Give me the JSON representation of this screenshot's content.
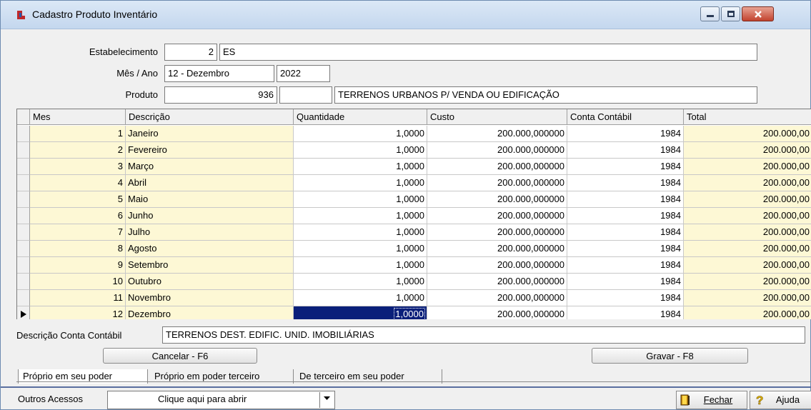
{
  "window": {
    "title": "Cadastro Produto  Inventário"
  },
  "form": {
    "estabelecimento_label": "Estabelecimento",
    "estabelecimento_code": "2",
    "estabelecimento_name": "ES",
    "mes_ano_label": "Mês / Ano",
    "mes_value": "12 - Dezembro",
    "ano_value": "2022",
    "produto_label": "Produto",
    "produto_code": "936",
    "produto_extra": "",
    "produto_desc": "TERRENOS URBANOS P/ VENDA OU EDIFICAÇÃO"
  },
  "grid": {
    "columns": [
      "Mes",
      "Descrição",
      "Quantidade",
      "Custo",
      "Conta Contábil",
      "Total"
    ],
    "rows": [
      {
        "mes": "1",
        "descricao": "Janeiro",
        "quantidade": "1,0000",
        "custo": "200.000,000000",
        "conta": "1984",
        "total": "200.000,00"
      },
      {
        "mes": "2",
        "descricao": "Fevereiro",
        "quantidade": "1,0000",
        "custo": "200.000,000000",
        "conta": "1984",
        "total": "200.000,00"
      },
      {
        "mes": "3",
        "descricao": "Março",
        "quantidade": "1,0000",
        "custo": "200.000,000000",
        "conta": "1984",
        "total": "200.000,00"
      },
      {
        "mes": "4",
        "descricao": "Abril",
        "quantidade": "1,0000",
        "custo": "200.000,000000",
        "conta": "1984",
        "total": "200.000,00"
      },
      {
        "mes": "5",
        "descricao": "Maio",
        "quantidade": "1,0000",
        "custo": "200.000,000000",
        "conta": "1984",
        "total": "200.000,00"
      },
      {
        "mes": "6",
        "descricao": "Junho",
        "quantidade": "1,0000",
        "custo": "200.000,000000",
        "conta": "1984",
        "total": "200.000,00"
      },
      {
        "mes": "7",
        "descricao": "Julho",
        "quantidade": "1,0000",
        "custo": "200.000,000000",
        "conta": "1984",
        "total": "200.000,00"
      },
      {
        "mes": "8",
        "descricao": "Agosto",
        "quantidade": "1,0000",
        "custo": "200.000,000000",
        "conta": "1984",
        "total": "200.000,00"
      },
      {
        "mes": "9",
        "descricao": "Setembro",
        "quantidade": "1,0000",
        "custo": "200.000,000000",
        "conta": "1984",
        "total": "200.000,00"
      },
      {
        "mes": "10",
        "descricao": "Outubro",
        "quantidade": "1,0000",
        "custo": "200.000,000000",
        "conta": "1984",
        "total": "200.000,00"
      },
      {
        "mes": "11",
        "descricao": "Novembro",
        "quantidade": "1,0000",
        "custo": "200.000,000000",
        "conta": "1984",
        "total": "200.000,00"
      },
      {
        "mes": "12",
        "descricao": "Dezembro",
        "quantidade": "1,0000",
        "custo": "200.000,000000",
        "conta": "1984",
        "total": "200.000,00"
      }
    ]
  },
  "conta": {
    "label": "Descrição Conta Contábil",
    "value": "TERRENOS DEST. EDIFIC. UNID. IMOBILIÁRIAS"
  },
  "buttons": {
    "cancelar": "Cancelar - F6",
    "gravar": "Gravar - F8"
  },
  "tabs": [
    "Próprio em seu poder",
    "Próprio em poder terceiro",
    "De terceiro em seu poder"
  ],
  "footer": {
    "outros_label": "Outros Acessos",
    "outros_value": "Clique aqui para abrir",
    "fechar": "Fechar",
    "ajuda": "Ajuda"
  },
  "icons": {
    "app": "app-logo-icon",
    "fechar": "door-exit-icon",
    "ajuda": "question-icon",
    "row_pointer": "row-pointer-icon"
  }
}
